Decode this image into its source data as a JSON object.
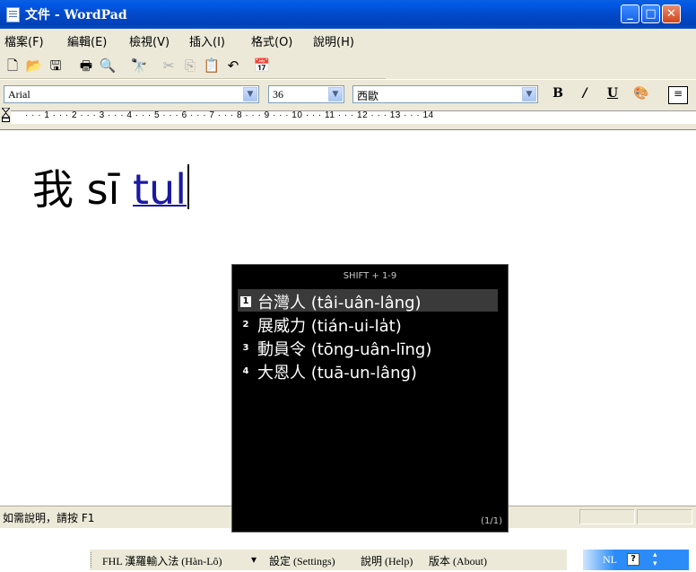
{
  "window": {
    "title": "文件 - WordPad",
    "minimize_glyph": "_",
    "maximize_glyph": "□",
    "close_glyph": "✕"
  },
  "menu": [
    "檔案(F)",
    "編輯(E)",
    "檢視(V)",
    "插入(I)",
    "格式(O)",
    "說明(H)"
  ],
  "toolbar": {
    "icons": [
      "new-icon",
      "open-icon",
      "save-icon",
      "print-icon",
      "print-preview-icon",
      "find-icon",
      "cut-icon",
      "copy-icon",
      "paste-icon",
      "undo-icon",
      "date-time-icon"
    ]
  },
  "format": {
    "font": "Arial",
    "size": "36",
    "script": "西歐",
    "bold": "B",
    "italic": "/",
    "underline": "U"
  },
  "ruler": {
    "text": "· · · 1 · · · 2 · · · 3 · · · 4 · · · 5 · · · 6 · · · 7 · · · 8 · · · 9 · · · 10 · · · 11 · · · 12 · · · 13 · · · 14"
  },
  "document": {
    "committed": "我 sī ",
    "composing": "tul"
  },
  "status": {
    "text": "如需說明，請按 F1"
  },
  "candidates": {
    "hint": "SHIFT + 1-9",
    "page": "(1/1)",
    "items": [
      {
        "num": "1",
        "label": "台灣人 (tâi-uân-lâng)"
      },
      {
        "num": "2",
        "label": "展威力 (tián-ui-la̍t)"
      },
      {
        "num": "3",
        "label": "動員令 (tōng-uân-līng)"
      },
      {
        "num": "4",
        "label": "大恩人 (tuā-un-lâng)"
      }
    ]
  },
  "ime_bar": {
    "name": "FHL 漢羅輸入法 (Hàn-Lô)",
    "dropdown": "▾",
    "settings": "設定 (Settings)",
    "help": "說明 (Help)",
    "about": "版本 (About)",
    "mode": "NL",
    "help_glyph": "?"
  }
}
